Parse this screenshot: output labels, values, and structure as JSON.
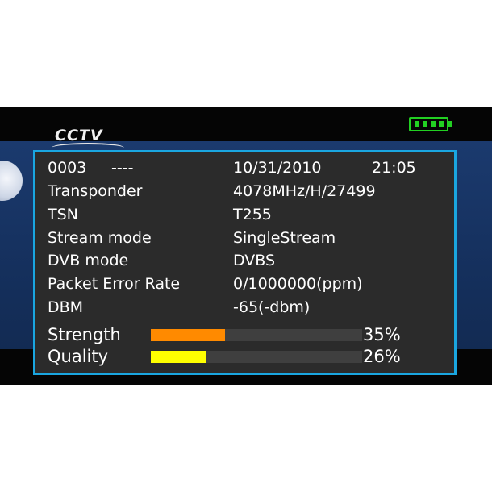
{
  "logo": {
    "text": "CCTV"
  },
  "header": {
    "channel_number": "0003",
    "channel_name": "----",
    "date": "10/31/2010",
    "time": "21:05"
  },
  "rows": [
    {
      "label": "Transponder",
      "value": "4078MHz/H/27499"
    },
    {
      "label": "TSN",
      "value": "T255"
    },
    {
      "label": "Stream mode",
      "value": "SingleStream"
    },
    {
      "label": "DVB mode",
      "value": "DVBS"
    },
    {
      "label": "Packet Error Rate",
      "value": "0/1000000(ppm)"
    },
    {
      "label": "DBM",
      "value": "-65(-dbm)"
    }
  ],
  "meters": [
    {
      "label": "Strength",
      "value": 35,
      "percent_text": "35%",
      "color": "#ff8a00"
    },
    {
      "label": "Quality",
      "value": 26,
      "percent_text": "26%",
      "color": "#ffff00"
    }
  ],
  "colors": {
    "panel_border": "#1aa6e0",
    "panel_bg": "#2b2b2b",
    "battery": "#22d022"
  },
  "icons": {
    "battery": "battery-full-icon"
  }
}
